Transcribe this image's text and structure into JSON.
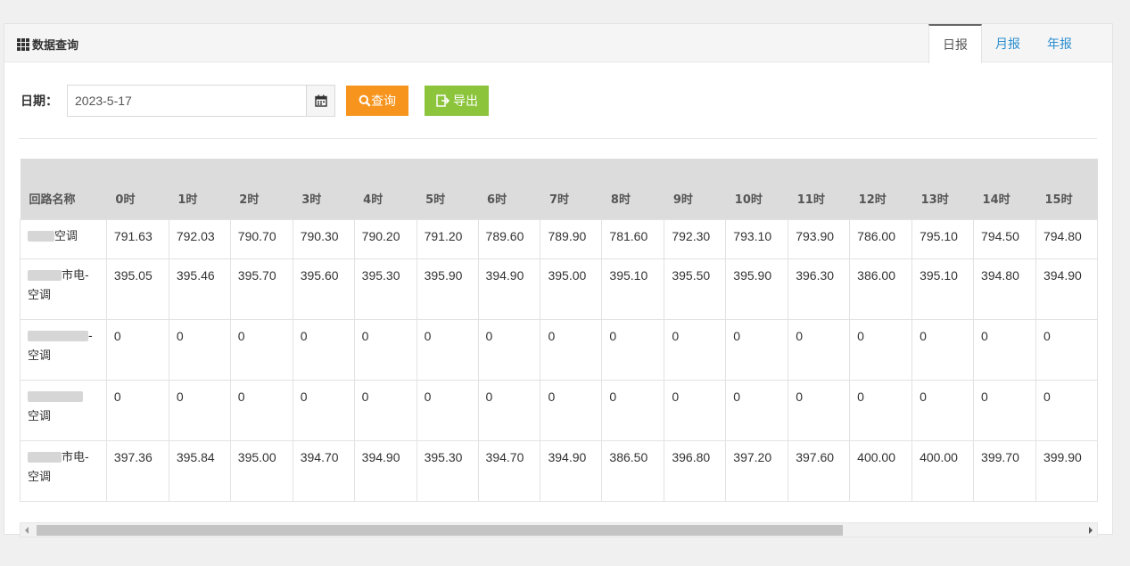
{
  "panel": {
    "title": "数据查询",
    "tabs": [
      {
        "label": "日报",
        "active": true
      },
      {
        "label": "月报",
        "active": false
      },
      {
        "label": "年报",
        "active": false
      }
    ]
  },
  "toolbar": {
    "date_label": "日期：",
    "date_value": "2023-5-17",
    "search_label": "查询",
    "export_label": "导出",
    "search_color": "#f7941d",
    "export_color": "#8cc43c"
  },
  "table": {
    "headers": [
      "回路名称",
      "0时",
      "1时",
      "2时",
      "3时",
      "4时",
      "5时",
      "6时",
      "7时",
      "8时",
      "9时",
      "10时",
      "11时",
      "12时",
      "13时",
      "14时",
      "15时"
    ],
    "rows": [
      {
        "name_suffix": "空调",
        "name_line2": "",
        "values": [
          "791.63",
          "792.03",
          "790.70",
          "790.30",
          "790.20",
          "791.20",
          "789.60",
          "789.90",
          "781.60",
          "792.30",
          "793.10",
          "793.90",
          "786.00",
          "795.10",
          "794.50",
          "794.80"
        ]
      },
      {
        "name_suffix": "市电-",
        "name_line2": "空调",
        "values": [
          "395.05",
          "395.46",
          "395.70",
          "395.60",
          "395.30",
          "395.90",
          "394.90",
          "395.00",
          "395.10",
          "395.50",
          "395.90",
          "396.30",
          "386.00",
          "395.10",
          "394.80",
          "394.90"
        ]
      },
      {
        "name_suffix": "-",
        "name_line2": "空调",
        "values": [
          "0",
          "0",
          "0",
          "0",
          "0",
          "0",
          "0",
          "0",
          "0",
          "0",
          "0",
          "0",
          "0",
          "0",
          "0",
          "0"
        ]
      },
      {
        "name_suffix": "",
        "name_line2": "空调",
        "values": [
          "0",
          "0",
          "0",
          "0",
          "0",
          "0",
          "0",
          "0",
          "0",
          "0",
          "0",
          "0",
          "0",
          "0",
          "0",
          "0"
        ]
      },
      {
        "name_suffix": "市电-",
        "name_line2": "空调",
        "values": [
          "397.36",
          "395.84",
          "395.00",
          "394.70",
          "394.90",
          "395.30",
          "394.70",
          "394.90",
          "386.50",
          "396.80",
          "397.20",
          "397.60",
          "400.00",
          "400.00",
          "399.70",
          "399.90"
        ]
      }
    ]
  }
}
